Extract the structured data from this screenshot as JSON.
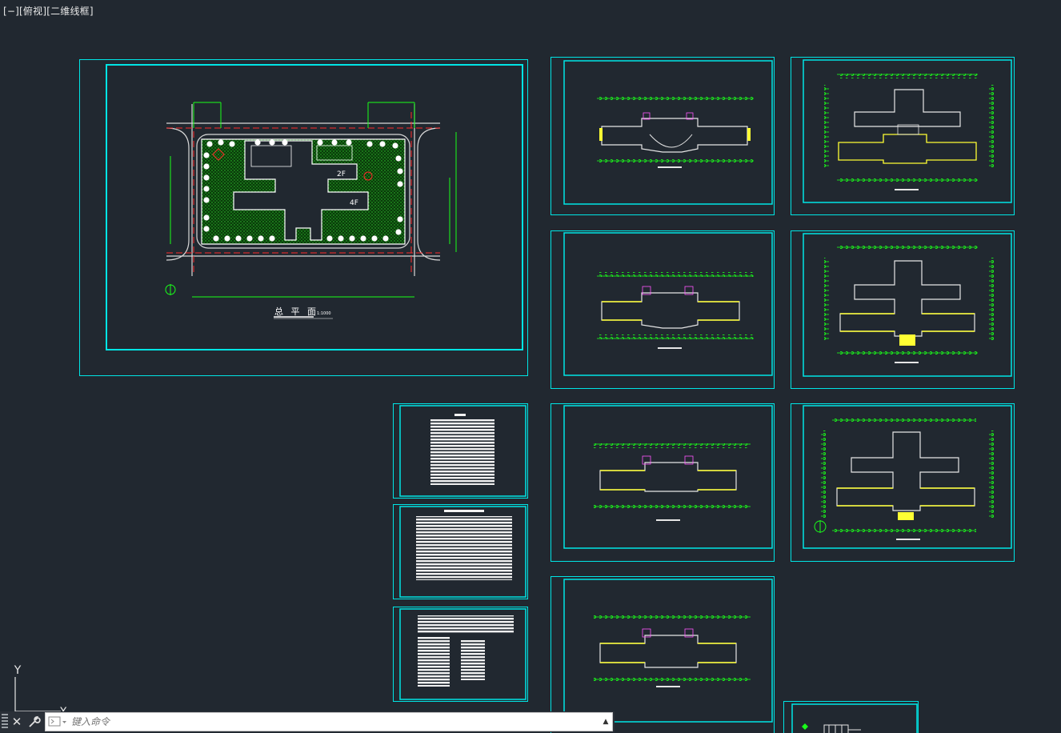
{
  "viewport": {
    "minimize": "[−]",
    "view": "[俯视]",
    "style": "[二维线框]"
  },
  "site_plan": {
    "title": "总 平 面",
    "scale": "1:1000",
    "label_2f": "2F",
    "label_4f": "4F"
  },
  "ucs": {
    "y": "Y",
    "x": "X"
  },
  "command_line": {
    "placeholder": "键入命令"
  },
  "colors": {
    "background": "#212830",
    "frame": "#00e5e5",
    "line_white": "#e6e6e6",
    "line_green": "#19ff19",
    "line_red": "#ff2a2a",
    "line_yellow": "#ffff33",
    "line_magenta": "#ff55ff"
  }
}
